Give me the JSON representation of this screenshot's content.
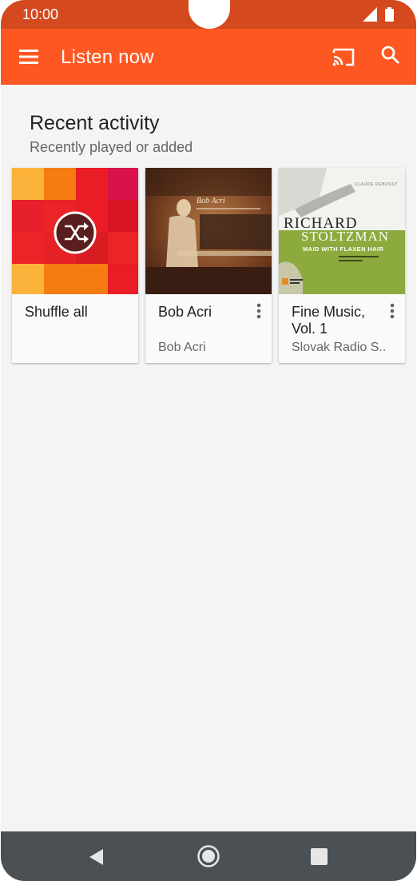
{
  "status_bar": {
    "time": "10:00"
  },
  "app_bar": {
    "title": "Listen now",
    "icons": [
      "menu-icon",
      "cast-icon",
      "search-icon"
    ]
  },
  "recent": {
    "title": "Recent activity",
    "subtitle": "Recently played or added",
    "cards": [
      {
        "title": "Shuffle all",
        "subtitle": "",
        "art": "shuffle-tiles"
      },
      {
        "title": "Bob Acri",
        "subtitle": "Bob Acri",
        "art": "album-cover-bob-acri",
        "art_text": "Bob Acri"
      },
      {
        "title": "Fine Music, Vol. 1",
        "subtitle": "Slovak Radio S..",
        "art": "album-cover-richard-stoltzman",
        "art_text": {
          "composer": "CLAUDE DEBUSSY",
          "line1": "RICHARD",
          "line2": "STOLTZMAN",
          "album": "MAID WITH FLAXEN HAIR"
        }
      }
    ]
  },
  "colors": {
    "status_bar": "#d4491e",
    "app_bar": "#fe5722",
    "background": "#f4f4f4",
    "nav_bar": "#4a5053"
  }
}
